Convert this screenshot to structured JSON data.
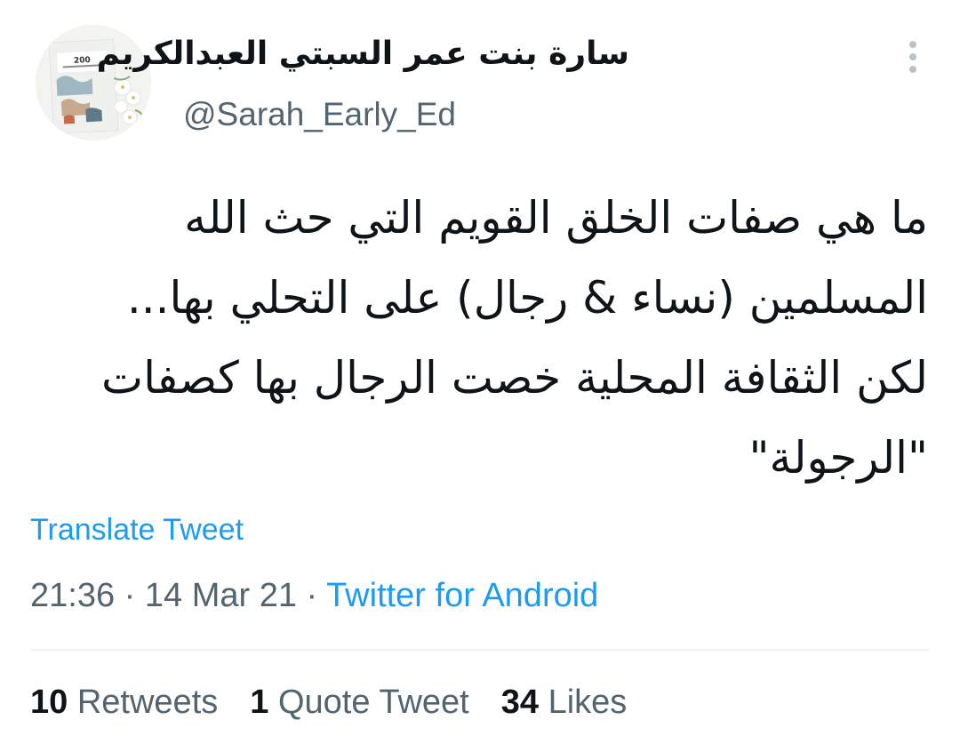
{
  "tweet": {
    "display_name": "سارة بنت عمر السبتي العبدالكريم",
    "handle": "@Sarah_Early_Ed",
    "text_lines": [
      "ما هي صفات الخلق القويم التي حث الله",
      "المسلمين (نساء & رجال) على التحلي بها...",
      "لكن الثقافة المحلية خصت الرجال بها كصفات",
      "\"الرجولة\""
    ],
    "translate_label": "Translate Tweet",
    "time": "21:36",
    "date": "14 Mar 21",
    "separator": "·",
    "source": "Twitter for Android"
  },
  "avatar": {
    "book_number": "200"
  },
  "stats": {
    "retweets_count": "10",
    "retweets_label": "Retweets",
    "quotes_count": "1",
    "quotes_label": "Quote Tweet",
    "likes_count": "34",
    "likes_label": "Likes"
  },
  "colors": {
    "link": "#1d9bf0",
    "secondary_text": "#536471",
    "primary_text": "#0f1419",
    "divider": "#eff3f4"
  },
  "icons": {
    "more": "vertical-ellipsis-icon"
  }
}
